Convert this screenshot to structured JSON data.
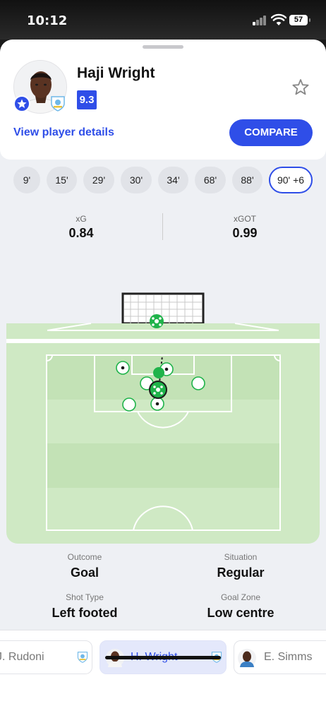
{
  "status_bar": {
    "time": "10:12",
    "battery": "57"
  },
  "player": {
    "name": "Haji Wright",
    "rating": "9.3",
    "details_link": "View player details",
    "compare_label": "COMPARE"
  },
  "shot_times": [
    "9'",
    "15'",
    "29'",
    "30'",
    "34'",
    "68'",
    "88'",
    "90' +6"
  ],
  "selected_shot": "90' +6",
  "stats": {
    "xg_label": "xG",
    "xg_value": "0.84",
    "xgot_label": "xGOT",
    "xgot_value": "0.99"
  },
  "details": {
    "outcome_label": "Outcome",
    "outcome_value": "Goal",
    "situation_label": "Situation",
    "situation_value": "Regular",
    "shot_type_label": "Shot Type",
    "shot_type_value": "Left footed",
    "goal_zone_label": "Goal Zone",
    "goal_zone_value": "Low centre"
  },
  "player_switcher": [
    "J. Rudoni",
    "H. Wright",
    "E. Simms"
  ],
  "colors": {
    "accent": "#2f4ee8",
    "pitch": "#cfe9c4",
    "goal_green": "#1fb34a"
  }
}
